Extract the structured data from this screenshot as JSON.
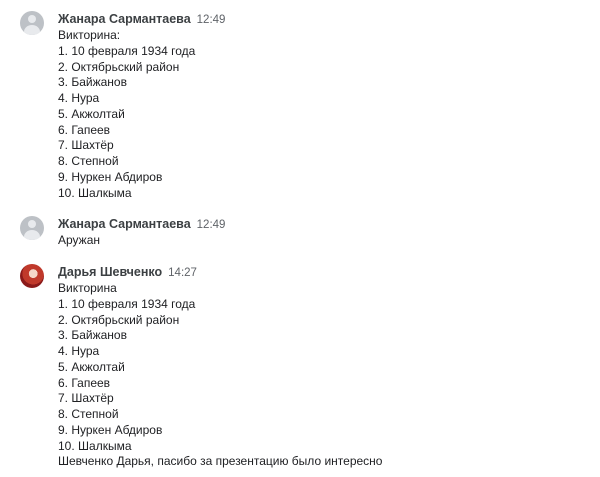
{
  "messages": [
    {
      "author": "Жанара Сармантаева",
      "time": "12:49",
      "avatar": "default-avatar",
      "lines": [
        "Викторина:",
        "1. 10 февраля 1934 года",
        "2. Октябрьский район",
        "3. Байжанов",
        "4. Нура",
        "5. Акжолтай",
        "6. Гапеев",
        "7. Шахтёр",
        "8. Степной",
        "9. Нуркен Абдиров",
        "10. Шалкыма"
      ]
    },
    {
      "author": "Жанара Сармантаева",
      "time": "12:49",
      "avatar": "default-avatar",
      "lines": [
        "Аружан"
      ]
    },
    {
      "author": "Дарья Шевченко",
      "time": "14:27",
      "avatar": "photo-avatar",
      "lines": [
        "Викторина",
        "1. 10 февраля 1934 года",
        "2. Октябрьский район",
        "3. Байжанов",
        "4. Нура",
        "5. Акжолтай",
        "6. Гапеев",
        "7. Шахтёр",
        "8. Степной",
        "9. Нуркен Абдиров",
        "10. Шалкыма",
        "Шевченко Дарья, пасибо за презентацию было интересно"
      ]
    }
  ]
}
